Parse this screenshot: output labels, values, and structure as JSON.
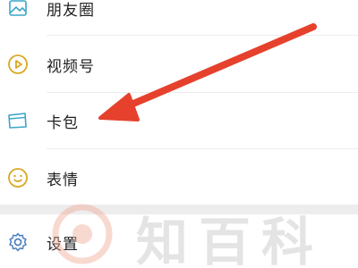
{
  "menu": {
    "items": [
      {
        "label": "朋友圈",
        "icon": "photo-icon"
      },
      {
        "label": "视频号",
        "icon": "play-circle-icon"
      },
      {
        "label": "卡包",
        "icon": "card-wallet-icon"
      },
      {
        "label": "表情",
        "icon": "smiley-icon"
      },
      {
        "label": "设置",
        "icon": "gear-icon"
      }
    ]
  },
  "annotation": {
    "type": "arrow",
    "color": "#e5412d",
    "points_to": "卡包"
  },
  "watermark": {
    "text": "知百科",
    "logo": "zhi-logo-icon"
  },
  "colors": {
    "icon_stroke": "#d9a826",
    "settings_icon_stroke": "#4a7fc1",
    "card_icon_stroke": "#3ba6c9",
    "arrow": "#e5412d",
    "text": "#1f1f1f",
    "divider": "#ececec",
    "section_gap": "#ededed"
  }
}
